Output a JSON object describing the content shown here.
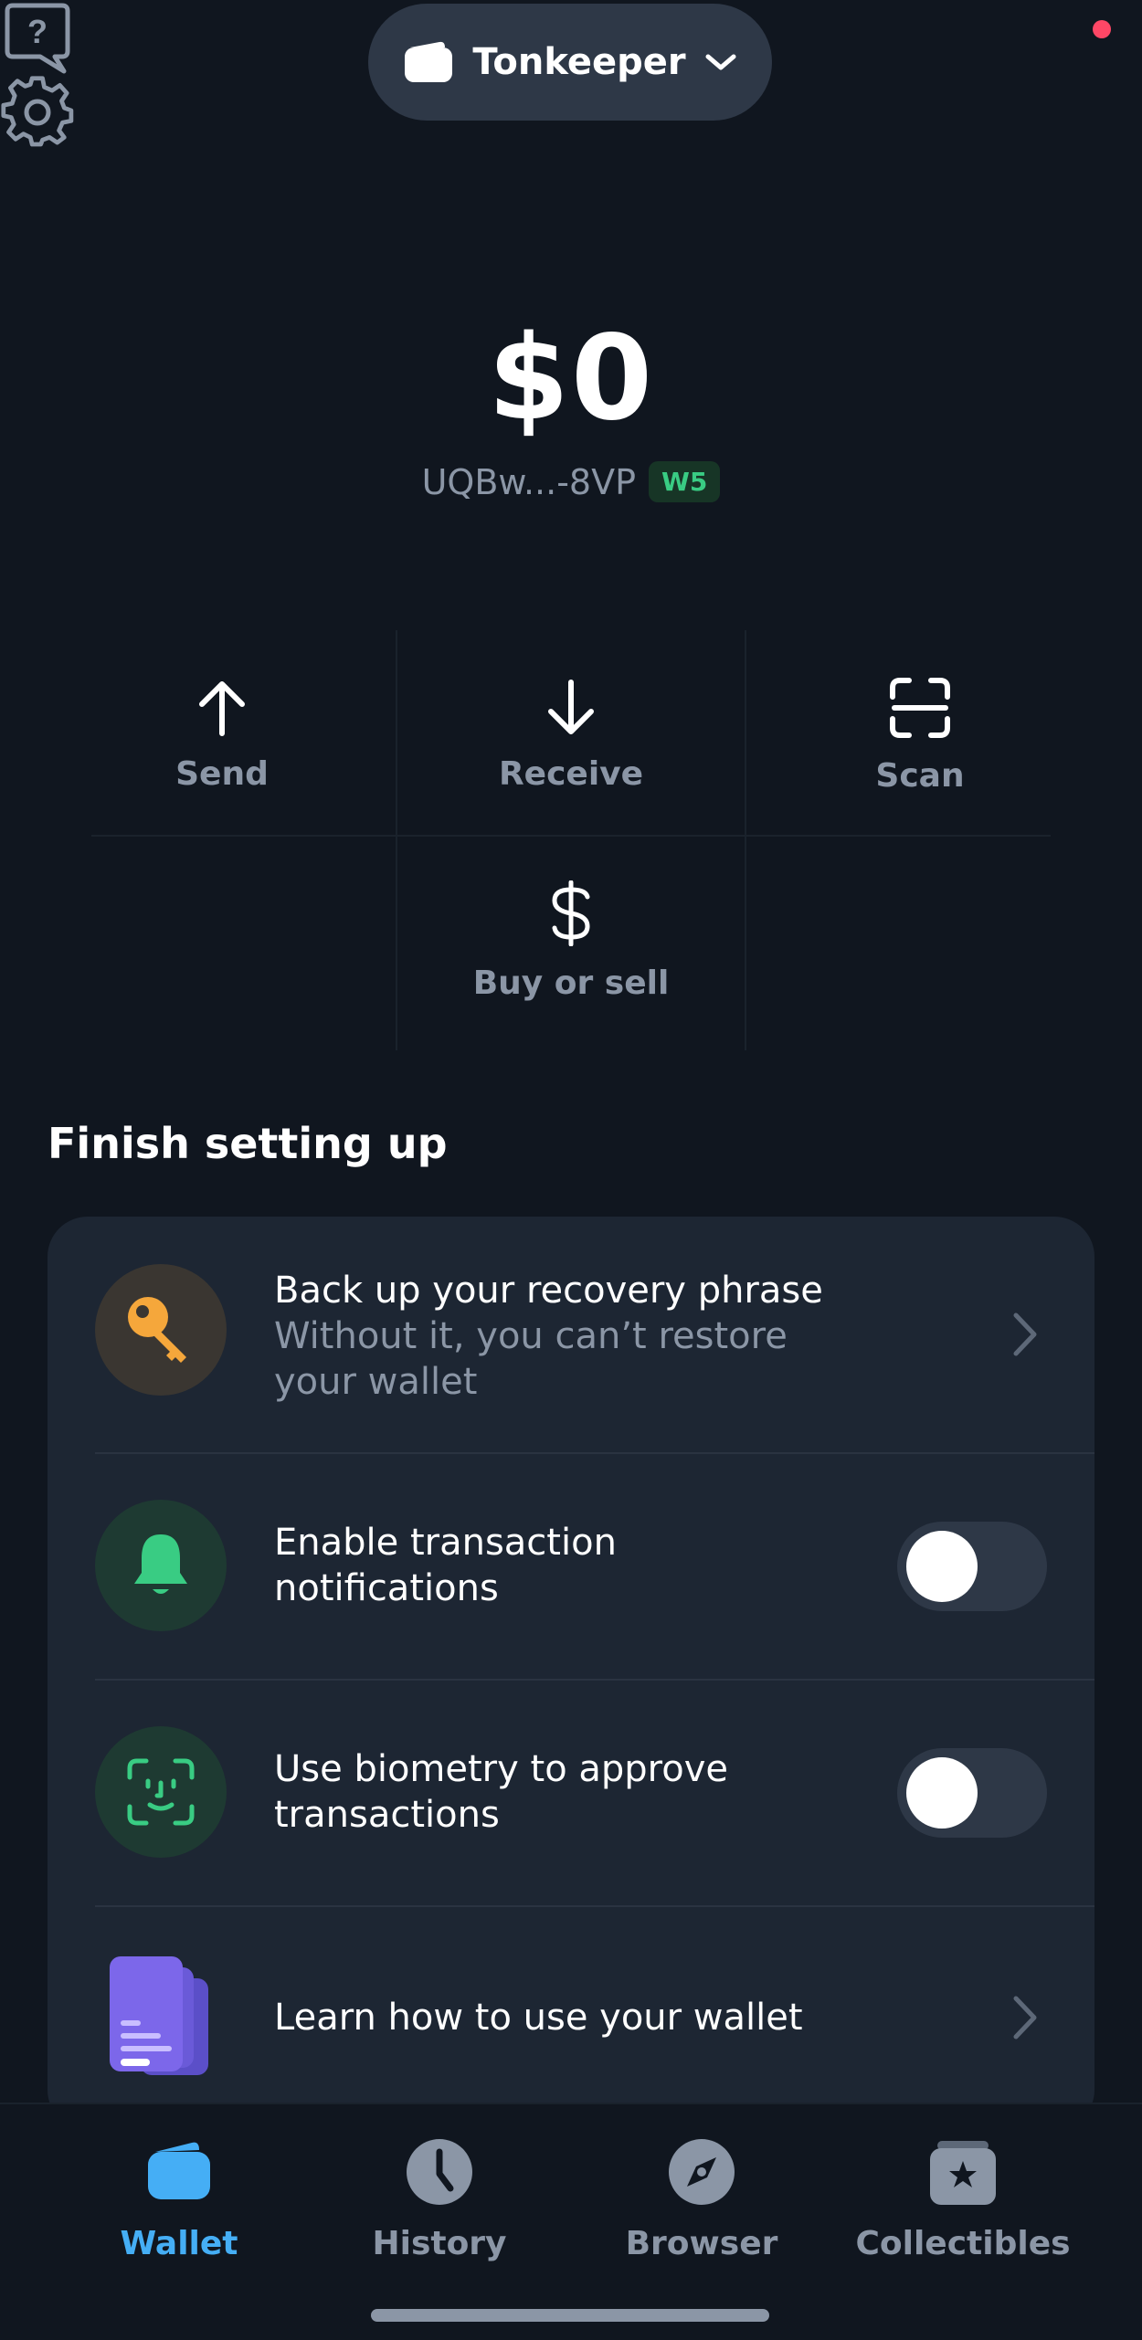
{
  "header": {
    "wallet_name": "Tonkeeper",
    "help_icon": "question-bubble-icon",
    "settings_icon": "gear-icon",
    "settings_has_notification": true
  },
  "balance": {
    "amount": "$0",
    "address": "UQBw...-8VP",
    "version_badge": "W5"
  },
  "actions": [
    {
      "label": "Send",
      "icon": "arrow-up-icon"
    },
    {
      "label": "Receive",
      "icon": "arrow-down-icon"
    },
    {
      "label": "Scan",
      "icon": "scan-icon"
    },
    {
      "label": "Buy or sell",
      "icon": "dollar-icon"
    }
  ],
  "setup": {
    "title": "Finish setting up",
    "items": [
      {
        "title": "Back up your recovery phrase",
        "subtitle_line1": "Without it, you can’t restore",
        "subtitle_line2": "your wallet",
        "icon": "key-icon"
      },
      {
        "title_line1": "Enable transaction",
        "title_line2": "notifications",
        "icon": "bell-icon",
        "toggle_on": false
      },
      {
        "title_line1": "Use biometry to approve",
        "title_line2": "transactions",
        "icon": "face-id-icon",
        "toggle_on": false
      },
      {
        "title": "Learn how to use your wallet",
        "icon": "document-stack-icon"
      }
    ]
  },
  "tabs": [
    {
      "label": "Wallet",
      "icon": "wallet-icon",
      "active": true
    },
    {
      "label": "History",
      "icon": "clock-icon",
      "active": false
    },
    {
      "label": "Browser",
      "icon": "compass-icon",
      "active": false
    },
    {
      "label": "Collectibles",
      "icon": "star-card-icon",
      "active": false
    }
  ],
  "colors": {
    "background": "#10161F",
    "card": "#1D2633",
    "accent_blue": "#45AEF5",
    "green": "#39CC83",
    "orange": "#F5A73B",
    "badge_red": "#FF4766",
    "secondary_text": "#8B96A6"
  }
}
